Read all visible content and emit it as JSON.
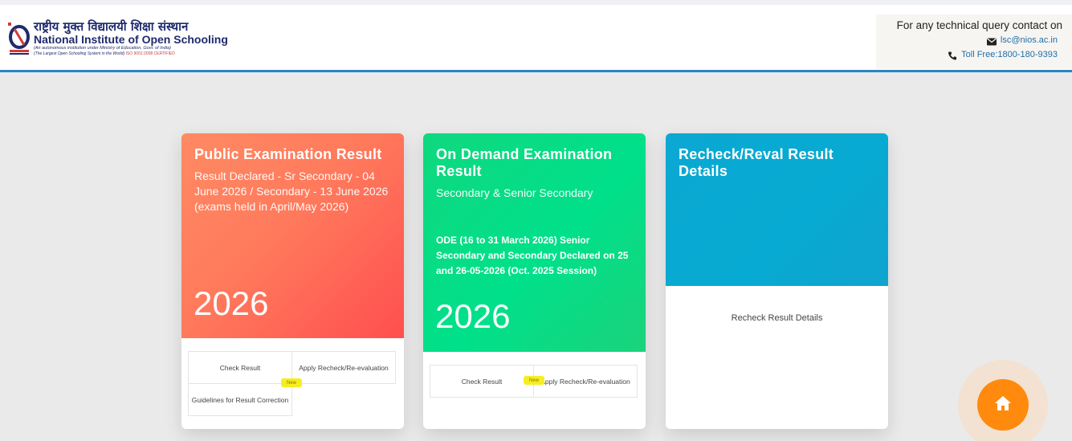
{
  "header": {
    "logo": {
      "hindi": "राष्ट्रीय मुक्त विद्यालयी शिक्षा संस्थान",
      "english_line1": "National Institute of ",
      "english_line2": "Open Schooling",
      "subtitle": "(An autonomous institution under Ministry of Education, Govt. of India)",
      "tagline": "(The Largest Open Schooling System in the World)",
      "iso": "ISO 9001:2008 CERTIFIED"
    },
    "contact": {
      "title": "For any technical query contact on",
      "email": "lsc@nios.ac.in",
      "phone": "Toll Free:1800-180-9393"
    }
  },
  "cards": [
    {
      "title": "Public Examination Result",
      "subtitle": "Result Declared - Sr Secondary - 04 June 2026 / Secondary - 13 June 2026 (exams held in April/May 2026)",
      "year": "2026",
      "links": {
        "check": "Check Result",
        "apply": "Apply Recheck/Re-evaluation",
        "guidelines": "Guidelines for Result Correction",
        "badge": "New"
      }
    },
    {
      "title": "On Demand Examination Result",
      "subtitle": "Secondary & Senior Secondary",
      "note": "ODE (16 to 31 March 2026) Senior Secondary and Secondary Declared on 25 and 26-05-2026 (Oct. 2025 Session)",
      "year": "2026",
      "links": {
        "check": "Check Result",
        "apply": "Apply Recheck/Re-evaluation",
        "badge": "New"
      }
    },
    {
      "title": "Recheck/Reval Result Details",
      "link": "Recheck Result Details"
    }
  ],
  "colors": {
    "header_border": "#2a86c4",
    "card1": "#ff6f5a",
    "card2": "#00e08a",
    "card3": "#07aad2",
    "home_button": "#ff8a0d"
  },
  "icons": {
    "email": "envelope-icon",
    "phone": "phone-icon",
    "home": "home-icon"
  }
}
